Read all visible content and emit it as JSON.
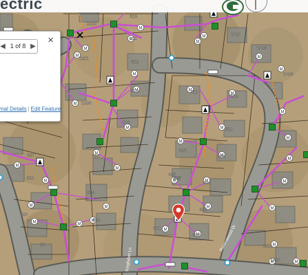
{
  "header": {
    "brand_text": "ectric",
    "logo": "utility-logo"
  },
  "popup": {
    "nav_prev": "◀",
    "nav_next": "▶",
    "counter": "1 of 8",
    "close": "✕",
    "link_left": "mal Details",
    "link_right": "Edit Feature",
    "link_separator": "|"
  },
  "map": {
    "lot_labels": [
      "1216",
      "518",
      "600",
      "512",
      "510",
      "508",
      "506",
      "1211",
      "1206",
      "511",
      "512",
      "510",
      "508",
      "507",
      "506",
      "505",
      "504",
      "507",
      "505",
      "504",
      "503",
      "503",
      "502",
      "501",
      "504",
      "502",
      "1303",
      "1305",
      "1308",
      "1401",
      "1403",
      "50"
    ],
    "street_labels": [
      "Ravenswood Dr",
      "Kingfisher Ln"
    ],
    "meter_label": "M",
    "colors": {
      "primary_line": "#c94fd4",
      "service_line": "#f08c1c",
      "transformer": "#1e8f2b",
      "meter_fill": "#ffffff",
      "road": "#9a9a94",
      "lot_line": "#2a2013",
      "pin": "#d43a2a"
    }
  }
}
